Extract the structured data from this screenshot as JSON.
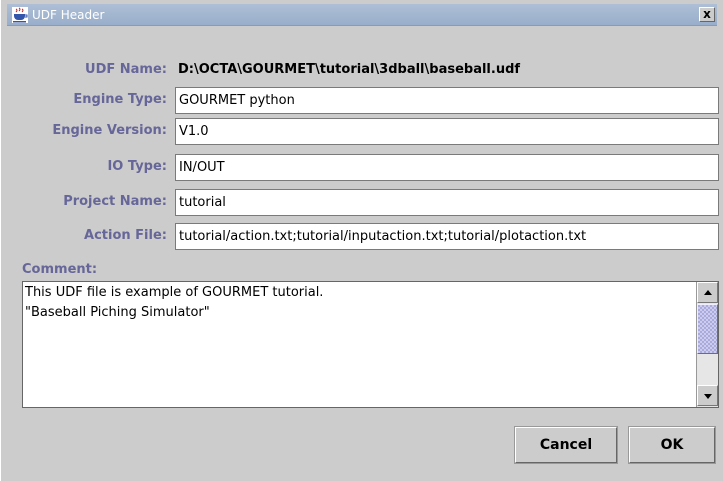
{
  "window": {
    "title": "UDF Header",
    "close_label": "x"
  },
  "form": {
    "rows": [
      {
        "label": "UDF Name:",
        "value": "D:\\OCTA\\GOURMET\\tutorial\\3dball\\baseball.udf"
      },
      {
        "label": "Engine Type:",
        "value": "GOURMET python"
      },
      {
        "label": "Engine Version:",
        "value": "V1.0"
      },
      {
        "label": "IO Type:",
        "value": "IN/OUT"
      },
      {
        "label": "Project Name:",
        "value": "tutorial"
      },
      {
        "label": "Action File:",
        "value": "tutorial/action.txt;tutorial/inputaction.txt;tutorial/plotaction.txt"
      }
    ]
  },
  "comment": {
    "label": "Comment:",
    "lines": [
      "This UDF file is example of GOURMET tutorial.",
      "\"Baseball Piching Simulator\""
    ]
  },
  "buttons": {
    "cancel": "Cancel",
    "ok": "OK"
  },
  "colors": {
    "label": "#666699",
    "titlebar": "#a4b6d0",
    "background": "#cccccc"
  }
}
